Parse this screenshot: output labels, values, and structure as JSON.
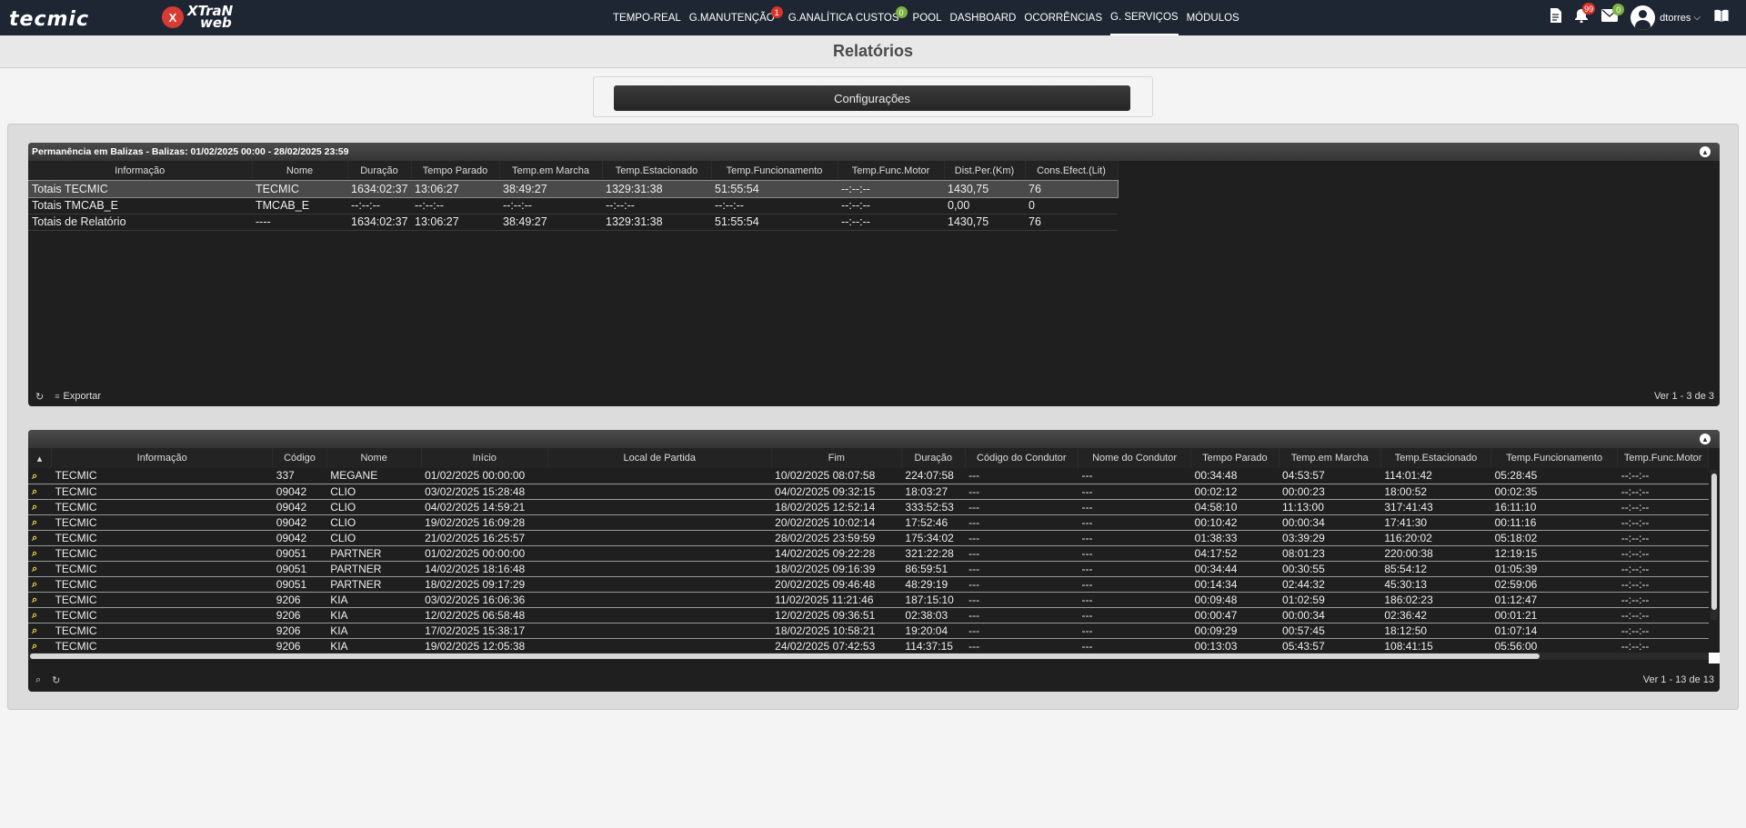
{
  "nav": {
    "logo_text": "tecmic",
    "xtran_badge": "X",
    "xtran_text_1": "XTraN",
    "xtran_text_2": "web",
    "items": [
      {
        "label": "TEMPO-REAL"
      },
      {
        "label": "G.MANUTENÇÃO",
        "badge": "1"
      },
      {
        "label": "G.ANALÍTICA CUSTOS",
        "badge": "0"
      },
      {
        "label": "POOL"
      },
      {
        "label": "DASHBOARD"
      },
      {
        "label": "OCORRÊNCIAS"
      },
      {
        "label": "G. SERVIÇOS"
      },
      {
        "label": "MÓDULOS"
      }
    ],
    "notifications_badge": "99",
    "messages_badge": "0",
    "username": "dtorres",
    "icons": {
      "document": "document-icon",
      "bell": "bell-icon",
      "mail": "mail-icon",
      "book": "book-icon"
    }
  },
  "page": {
    "title": "Relatórios",
    "config_label": "Configurações"
  },
  "panel1": {
    "title": "Permanência em Balizas - Balizas: 01/02/2025 00:00 - 28/02/2025 23:59",
    "headers": [
      "Informação",
      "Nome",
      "Duração",
      "Tempo Parado",
      "Temp.em Marcha",
      "Temp.Estacionado",
      "Temp.Funcionamento",
      "Temp.Func.Motor",
      "Dist.Per.(Km)",
      "Cons.Efect.(Lit)"
    ],
    "rows": [
      [
        "Totais TECMIC",
        "TECMIC",
        "1634:02:37",
        "13:06:27",
        "38:49:27",
        "1329:31:38",
        "51:55:54",
        "--:--:--",
        "1430,75",
        "76"
      ],
      [
        "Totais TMCAB_E",
        "TMCAB_E",
        "--:--:--",
        "--:--:--",
        "--:--:--",
        "--:--:--",
        "--:--:--",
        "--:--:--",
        "0,00",
        "0"
      ],
      [
        "Totais de Relatório",
        "----",
        "1634:02:37",
        "13:06:27",
        "38:49:27",
        "1329:31:38",
        "51:55:54",
        "--:--:--",
        "1430,75",
        "76"
      ]
    ],
    "export_label": "Exportar",
    "pager": "Ver 1 - 3 de 3"
  },
  "panel2": {
    "headers": [
      "Informação",
      "Código",
      "Nome",
      "Início",
      "Local de Partida",
      "Fim",
      "Duração",
      "Código do Condutor",
      "Nome do Condutor",
      "Tempo Parado",
      "Temp.em Marcha",
      "Temp.Estacionado",
      "Temp.Funcionamento",
      "Temp.Func.Motor"
    ],
    "rows": [
      [
        "TECMIC",
        "337",
        "MEGANE",
        "01/02/2025 00:00:00",
        "",
        "10/02/2025 08:07:58",
        "224:07:58",
        "---",
        "---",
        "00:34:48",
        "04:53:57",
        "114:01:42",
        "05:28:45",
        "--:--:--"
      ],
      [
        "TECMIC",
        "09042",
        "CLIO",
        "03/02/2025 15:28:48",
        "",
        "04/02/2025 09:32:15",
        "18:03:27",
        "---",
        "---",
        "00:02:12",
        "00:00:23",
        "18:00:52",
        "00:02:35",
        "--:--:--"
      ],
      [
        "TECMIC",
        "09042",
        "CLIO",
        "04/02/2025 14:59:21",
        "",
        "18/02/2025 12:52:14",
        "333:52:53",
        "---",
        "---",
        "04:58:10",
        "11:13:00",
        "317:41:43",
        "16:11:10",
        "--:--:--"
      ],
      [
        "TECMIC",
        "09042",
        "CLIO",
        "19/02/2025 16:09:28",
        "",
        "20/02/2025 10:02:14",
        "17:52:46",
        "---",
        "---",
        "00:10:42",
        "00:00:34",
        "17:41:30",
        "00:11:16",
        "--:--:--"
      ],
      [
        "TECMIC",
        "09042",
        "CLIO",
        "21/02/2025 16:25:57",
        "",
        "28/02/2025 23:59:59",
        "175:34:02",
        "---",
        "---",
        "01:38:33",
        "03:39:29",
        "116:20:02",
        "05:18:02",
        "--:--:--"
      ],
      [
        "TECMIC",
        "09051",
        "PARTNER",
        "01/02/2025 00:00:00",
        "",
        "14/02/2025 09:22:28",
        "321:22:28",
        "---",
        "---",
        "04:17:52",
        "08:01:23",
        "220:00:38",
        "12:19:15",
        "--:--:--"
      ],
      [
        "TECMIC",
        "09051",
        "PARTNER",
        "14/02/2025 18:16:48",
        "",
        "18/02/2025 09:16:39",
        "86:59:51",
        "---",
        "---",
        "00:34:44",
        "00:30:55",
        "85:54:12",
        "01:05:39",
        "--:--:--"
      ],
      [
        "TECMIC",
        "09051",
        "PARTNER",
        "18/02/2025 09:17:29",
        "",
        "20/02/2025 09:46:48",
        "48:29:19",
        "---",
        "---",
        "00:14:34",
        "02:44:32",
        "45:30:13",
        "02:59:06",
        "--:--:--"
      ],
      [
        "TECMIC",
        "9206",
        "KIA",
        "03/02/2025 16:06:36",
        "",
        "11/02/2025 11:21:46",
        "187:15:10",
        "---",
        "---",
        "00:09:48",
        "01:02:59",
        "186:02:23",
        "01:12:47",
        "--:--:--"
      ],
      [
        "TECMIC",
        "9206",
        "KIA",
        "12/02/2025 06:58:48",
        "",
        "12/02/2025 09:36:51",
        "02:38:03",
        "---",
        "---",
        "00:00:47",
        "00:00:34",
        "02:36:42",
        "00:01:21",
        "--:--:--"
      ],
      [
        "TECMIC",
        "9206",
        "KIA",
        "17/02/2025 15:38:17",
        "",
        "18/02/2025 10:58:21",
        "19:20:04",
        "---",
        "---",
        "00:09:29",
        "00:57:45",
        "18:12:50",
        "01:07:14",
        "--:--:--"
      ],
      [
        "TECMIC",
        "9206",
        "KIA",
        "19/02/2025 12:05:38",
        "",
        "24/02/2025 07:42:53",
        "114:37:15",
        "---",
        "---",
        "00:13:03",
        "05:43:57",
        "108:41:15",
        "05:56:00",
        "--:--:--"
      ]
    ],
    "pager": "Ver 1 - 13 de 13"
  }
}
